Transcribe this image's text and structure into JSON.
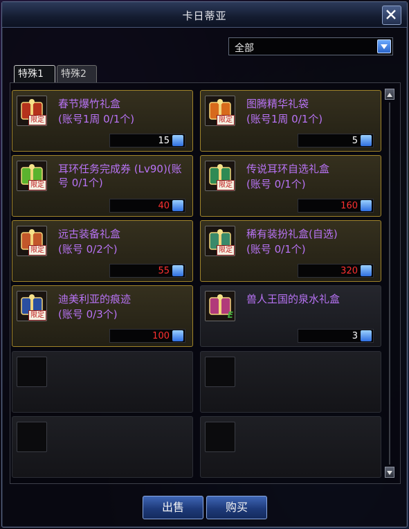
{
  "window": {
    "title": "卡日蒂亚"
  },
  "filter": {
    "selected": "全部"
  },
  "tabs": [
    {
      "label": "特殊1"
    },
    {
      "label": "特殊2"
    }
  ],
  "items": [
    {
      "name": "春节爆竹礼盒",
      "limit": "(账号1周 0/1个)",
      "price": "15",
      "price_color": "white",
      "badge": "限定",
      "icon": "firecracker-gift-box",
      "accent": "#b5321c"
    },
    {
      "name": "图腾精华礼袋",
      "limit": "(账号1周 0/1个)",
      "price": "5",
      "price_color": "white",
      "badge": "限定",
      "icon": "totem-gift-bag",
      "accent": "#d76a1c"
    },
    {
      "name": "耳环任务完成券 (Lv90)(账号 0/1个)",
      "limit": "",
      "price": "40",
      "price_color": "red",
      "badge": "限定",
      "icon": "earring-quest-ticket",
      "accent": "#5bb32e"
    },
    {
      "name": "传说耳环自选礼盒",
      "limit": "(账号 0/1个)",
      "price": "160",
      "price_color": "red",
      "badge": "限定",
      "icon": "earring-select-box",
      "accent": "#2f8a54"
    },
    {
      "name": "远古装备礼盒",
      "limit": "(账号 0/2个)",
      "price": "55",
      "price_color": "red",
      "badge": "限定",
      "icon": "ancient-equipment-box",
      "accent": "#c2572a"
    },
    {
      "name": "稀有装扮礼盒(自选)",
      "limit": "(账号 0/1个)",
      "price": "320",
      "price_color": "red",
      "badge": "限定",
      "icon": "rare-avatar-box",
      "accent": "#3a8a6a"
    },
    {
      "name": "迪美利亚的痕迹",
      "limit": "(账号 0/3个)",
      "price": "100",
      "price_color": "red",
      "badge": "限定",
      "icon": "demeria-trace-chest",
      "accent": "#2a4fa0"
    },
    {
      "name": "兽人王国的泉水礼盒",
      "limit": "",
      "price": "3",
      "price_color": "white",
      "badge": "E",
      "icon": "orc-spring-gift-box",
      "accent": "#b13a7a"
    }
  ],
  "buttons": {
    "sell": "出售",
    "buy": "购买"
  },
  "colors": {
    "item_name": "#b873f5",
    "price_red": "#ff3030",
    "limited_border": "#a0842a"
  }
}
